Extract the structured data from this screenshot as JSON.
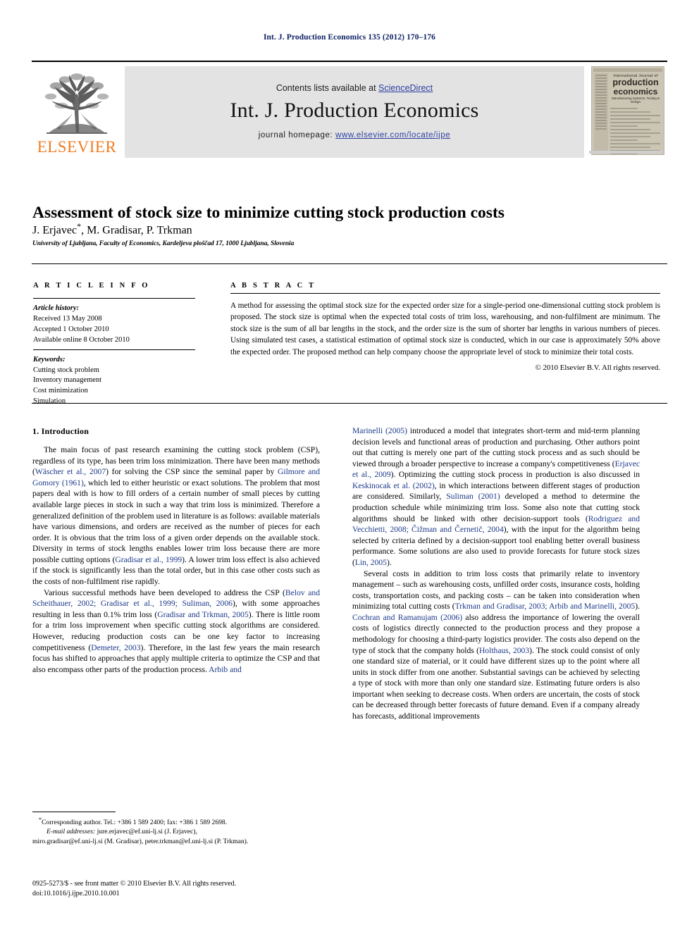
{
  "running_head": "Int. J. Production Economics 135 (2012) 170–176",
  "masthead": {
    "publisher": "ELSEVIER",
    "contents_prefix": "Contents lists available at ",
    "sciencedirect": "ScienceDirect",
    "journal_title": "Int. J. Production Economics",
    "homepage_prefix": "journal homepage: ",
    "homepage_url": "www.elsevier.com/locate/ijpe",
    "cover": {
      "line1": "International Journal of",
      "line2": "production",
      "line3": "economics",
      "line4": "Manufacturing Systems, Tooling & Design"
    },
    "colors": {
      "elsevier_orange": "#f07c22",
      "band_gray": "#e3e3e3",
      "link_blue": "#2b3fa0"
    }
  },
  "article": {
    "title": "Assessment of stock size to minimize cutting stock production costs",
    "authors": "J. Erjavec",
    "authors_rest": ", M. Gradisar, P. Trkman",
    "corresponding_mark": "*",
    "affiliation": "University of Ljubljana, Faculty of Economics, Kardeljeva ploščad 17, 1000 Ljubljana, Slovenia"
  },
  "info": {
    "heading": "A R T I C L E   I N F O",
    "history_label": "Article history:",
    "history": [
      "Received 13 May 2008",
      "Accepted 1 October 2010",
      "Available online 8 October 2010"
    ],
    "keywords_label": "Keywords:",
    "keywords": [
      "Cutting stock problem",
      "Inventory management",
      "Cost minimization",
      "Simulation"
    ]
  },
  "abstract": {
    "heading": "A B S T R A C T",
    "text": "A method for assessing the optimal stock size for the expected order size for a single-period one-dimensional cutting stock problem is proposed. The stock size is optimal when the expected total costs of trim loss, warehousing, and non-fulfilment are minimum. The stock size is the sum of all bar lengths in the stock, and the order size is the sum of shorter bar lengths in various numbers of pieces. Using simulated test cases, a statistical estimation of optimal stock size is conducted, which in our case is approximately 50% above the expected order. The proposed method can help company choose the appropriate level of stock to minimize their total costs.",
    "copyright": "© 2010 Elsevier B.V. All rights reserved."
  },
  "body": {
    "section_heading": "1.  Introduction",
    "left_paragraphs": [
      {
        "runs": [
          {
            "t": "The main focus of past research examining the cutting stock problem (CSP), regardless of its type, has been trim loss minimization. There have been many methods ("
          },
          {
            "t": "Wäscher et al., 2007",
            "cite": true
          },
          {
            "t": ") for solving the CSP since the seminal paper by "
          },
          {
            "t": "Gilmore and Gomory (1961)",
            "cite": true
          },
          {
            "t": ", which led to either heuristic or exact solutions. The problem that most papers deal with is how to fill orders of a certain number of small pieces by cutting available large pieces in stock in such a way that trim loss is minimized. Therefore a generalized definition of the problem used in literature is as follows: available materials have various dimensions, and orders are received as the number of pieces for each order. It is obvious that the trim loss of a given order depends on the available stock. Diversity in terms of stock lengths enables lower trim loss because there are more possible cutting options ("
          },
          {
            "t": "Gradisar et al., 1999",
            "cite": true
          },
          {
            "t": "). A lower trim loss effect is also achieved if the stock is significantly less than the total order, but in this case other costs such as the costs of non-fulfilment rise rapidly."
          }
        ]
      },
      {
        "runs": [
          {
            "t": "Various successful methods have been developed to address the CSP ("
          },
          {
            "t": "Belov and Scheithauer, 2002; Gradisar et al., 1999; Suliman, 2006",
            "cite": true
          },
          {
            "t": "), with some approaches resulting in less than 0.1% trim loss ("
          },
          {
            "t": "Gradisar and Trkman, 2005",
            "cite": true
          },
          {
            "t": "). There is little room for a trim loss improvement when specific cutting stock algorithms are considered. However, reducing production costs can be one key factor to increasing competitiveness ("
          },
          {
            "t": "Demeter, 2003",
            "cite": true
          },
          {
            "t": "). Therefore, in the last few years the main research focus has shifted to approaches that apply multiple criteria to optimize the CSP and that also encompass other parts of the production process. "
          },
          {
            "t": "Arbib and",
            "cite": true
          }
        ]
      }
    ],
    "right_paragraphs": [
      {
        "runs": [
          {
            "t": "Marinelli (2005)",
            "cite": true
          },
          {
            "t": " introduced a model that integrates short-term and mid-term planning decision levels and functional areas of production and purchasing. Other authors point out that cutting is merely one part of the cutting stock process and as such should be viewed through a broader perspective to increase a company's competitiveness ("
          },
          {
            "t": "Erjavec et al., 2009",
            "cite": true
          },
          {
            "t": "). Optimizing the cutting stock process in production is also discussed in "
          },
          {
            "t": "Keskinocak et al. (2002)",
            "cite": true
          },
          {
            "t": ", in which interactions between different stages of production are considered. Similarly, "
          },
          {
            "t": "Suliman (2001)",
            "cite": true
          },
          {
            "t": " developed a method to determine the production schedule while minimizing trim loss. Some also note that cutting stock algorithms should be linked with other decision-support tools ("
          },
          {
            "t": "Rodriguez and Vecchietti, 2008; Čižman and Černetič, 2004",
            "cite": true
          },
          {
            "t": "), with the input for the algorithm being selected by criteria defined by a decision-support tool enabling better overall business performance. Some solutions are also used to provide forecasts for future stock sizes ("
          },
          {
            "t": "Lin, 2005",
            "cite": true
          },
          {
            "t": ")."
          }
        ]
      },
      {
        "runs": [
          {
            "t": "Several costs in addition to trim loss costs that primarily relate to inventory management – such as warehousing costs, unfilled order costs, insurance costs, holding costs, transportation costs, and packing costs – can be taken into consideration when minimizing total cutting costs ("
          },
          {
            "t": "Trkman and Gradisar, 2003; Arbib and Marinelli, 2005",
            "cite": true
          },
          {
            "t": "). "
          },
          {
            "t": "Cochran and Ramanujam (2006)",
            "cite": true
          },
          {
            "t": " also address the importance of lowering the overall costs of logistics directly connected to the production process and they propose a methodology for choosing a third-party logistics provider. The costs also depend on the type of stock that the company holds ("
          },
          {
            "t": "Holthaus, 2003",
            "cite": true
          },
          {
            "t": "). The stock could consist of only one standard size of material, or it could have different sizes up to the point where all units in stock differ from one another. Substantial savings can be achieved by selecting a type of stock with more than only one standard size. Estimating future orders is also important when seeking to decrease costs. When orders are uncertain, the costs of stock can be decreased through better forecasts of future demand. Even if a company already has forecasts, additional improvements"
          }
        ]
      }
    ]
  },
  "footnote": {
    "corresponding": "Corresponding author. Tel.: +386 1 589 2400; fax: +386 1 589 2698.",
    "email_label": "E-mail addresses:",
    "email_line1": " jure.erjavec@ef.uni-lj.si (J. Erjavec),",
    "email_line2": "miro.gradisar@ef.uni-lj.si (M. Gradisar), peter.trkman@ef.uni-lj.si (P. Trkman)."
  },
  "imprint": {
    "line1": "0925-5273/$ - see front matter © 2010 Elsevier B.V. All rights reserved.",
    "line2": "doi:10.1016/j.ijpe.2010.10.001"
  }
}
